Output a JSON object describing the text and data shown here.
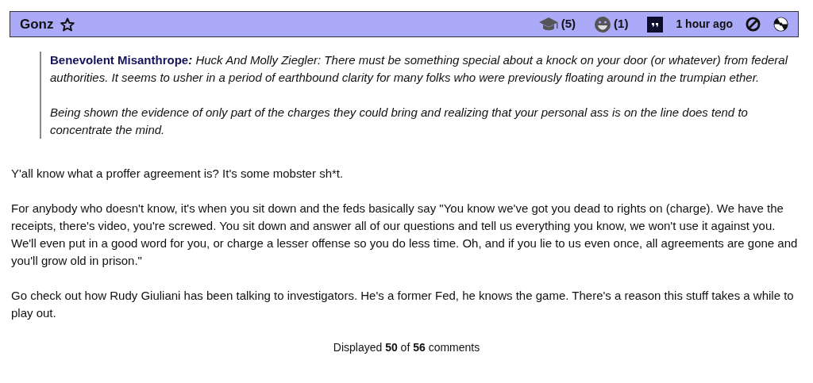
{
  "comment_header": {
    "author": "Gonz",
    "badges": [
      {
        "kind": "cap",
        "count": "(5)"
      },
      {
        "kind": "smile",
        "count": "(1)"
      }
    ],
    "time": "1 hour ago"
  },
  "quote": {
    "author": "Benevolent Misanthrope",
    "paragraphs": [
      "**:** *Huck And Molly Ziegler: There must be something special about a knock on your door (or whatever) from federal authorities. It seems to usher in a period of earthbound clarity for many folks who were previously floating around in the trumpian ether.*",
      "*Being shown the evidence of only part of the charges they could bring and realizing that your personal ass is on the line does tend to concentrate the mind.*"
    ]
  },
  "body": [
    "Y'all know what a proffer agreement is? It's some mobster sh*t.",
    "For anybody who doesn't know, it's when you sit down and the feds basically say \"You know we've got you dead to rights on (charge). We have the receipts, there's video, you're screwed. You sit down and answer all of our questions and tell us everything you know, we won't use it against you. We'll even put in a good word for you, or charge a lesser offense so you do less time. Oh, and if you lie to us even once, all agreements are gone and you'll grow old in prison.\"",
    "Go check out how Rudy Giuliani has been talking to investigators. He's a former Fed, he knows the game. There's a reason this stuff takes a while to play out."
  ],
  "footer": "Displayed **50** of **56** comments"
}
